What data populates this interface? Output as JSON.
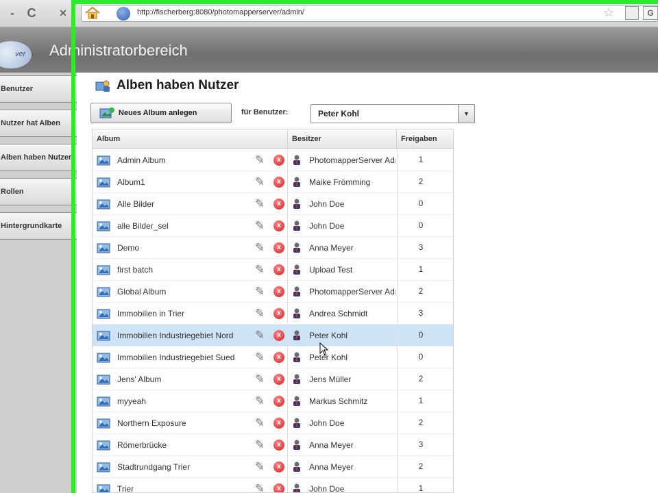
{
  "browser": {
    "url": "http://fischerberg:8080/photomapperserver/admin/",
    "reload_label": "C"
  },
  "app": {
    "title": "Administratorbereich",
    "logo_text": "ver"
  },
  "sidebar": {
    "items": [
      {
        "label": "Benutzer"
      },
      {
        "label": "Nutzer hat Alben"
      },
      {
        "label": "Alben haben Nutzer"
      },
      {
        "label": "Rollen"
      },
      {
        "label": "Hintergrundkarte"
      }
    ]
  },
  "panel": {
    "title": "Alben haben Nutzer",
    "new_album_label": "Neues Album anlegen",
    "for_user_label": "für Benutzer:",
    "selected_user": "Peter Kohl"
  },
  "grid": {
    "columns": [
      "Album",
      "Besitzer",
      "Freigaben"
    ],
    "rows": [
      {
        "album": "Admin Album",
        "owner": "PhotomapperServer Admin",
        "shares": "1"
      },
      {
        "album": "Album1",
        "owner": "Maike Frömming",
        "shares": "2"
      },
      {
        "album": "Alle Bilder",
        "owner": "John Doe",
        "shares": "0"
      },
      {
        "album": "alle Bilder_sel",
        "owner": "John Doe",
        "shares": "0"
      },
      {
        "album": "Demo",
        "owner": "Anna Meyer",
        "shares": "3"
      },
      {
        "album": "first batch",
        "owner": "Upload Test",
        "shares": "1"
      },
      {
        "album": "Global Album",
        "owner": "PhotomapperServer Admin",
        "shares": "2"
      },
      {
        "album": "Immobilien in Trier",
        "owner": "Andrea Schmidt",
        "shares": "3"
      },
      {
        "album": "Immobilien Industriegebiet Nord",
        "owner": "Peter Kohl",
        "shares": "0",
        "selected": true
      },
      {
        "album": "Immobilien Industriegebiet Sued",
        "owner": "Peter Kohl",
        "shares": "0"
      },
      {
        "album": "Jens' Album",
        "owner": "Jens Müller",
        "shares": "2"
      },
      {
        "album": "myyeah",
        "owner": "Markus Schmitz",
        "shares": "1"
      },
      {
        "album": "Northern Exposure",
        "owner": "John Doe",
        "shares": "2"
      },
      {
        "album": "Römerbrücke",
        "owner": "Anna Meyer",
        "shares": "3"
      },
      {
        "album": "Stadtrundgang Trier",
        "owner": "Anna Meyer",
        "shares": "2"
      },
      {
        "album": "Trier",
        "owner": "John Doe",
        "shares": "1"
      }
    ]
  },
  "colors": {
    "accent_green": "#2eea2e",
    "selection": "#cfe3f7",
    "delete_red": "#d21b1b"
  }
}
